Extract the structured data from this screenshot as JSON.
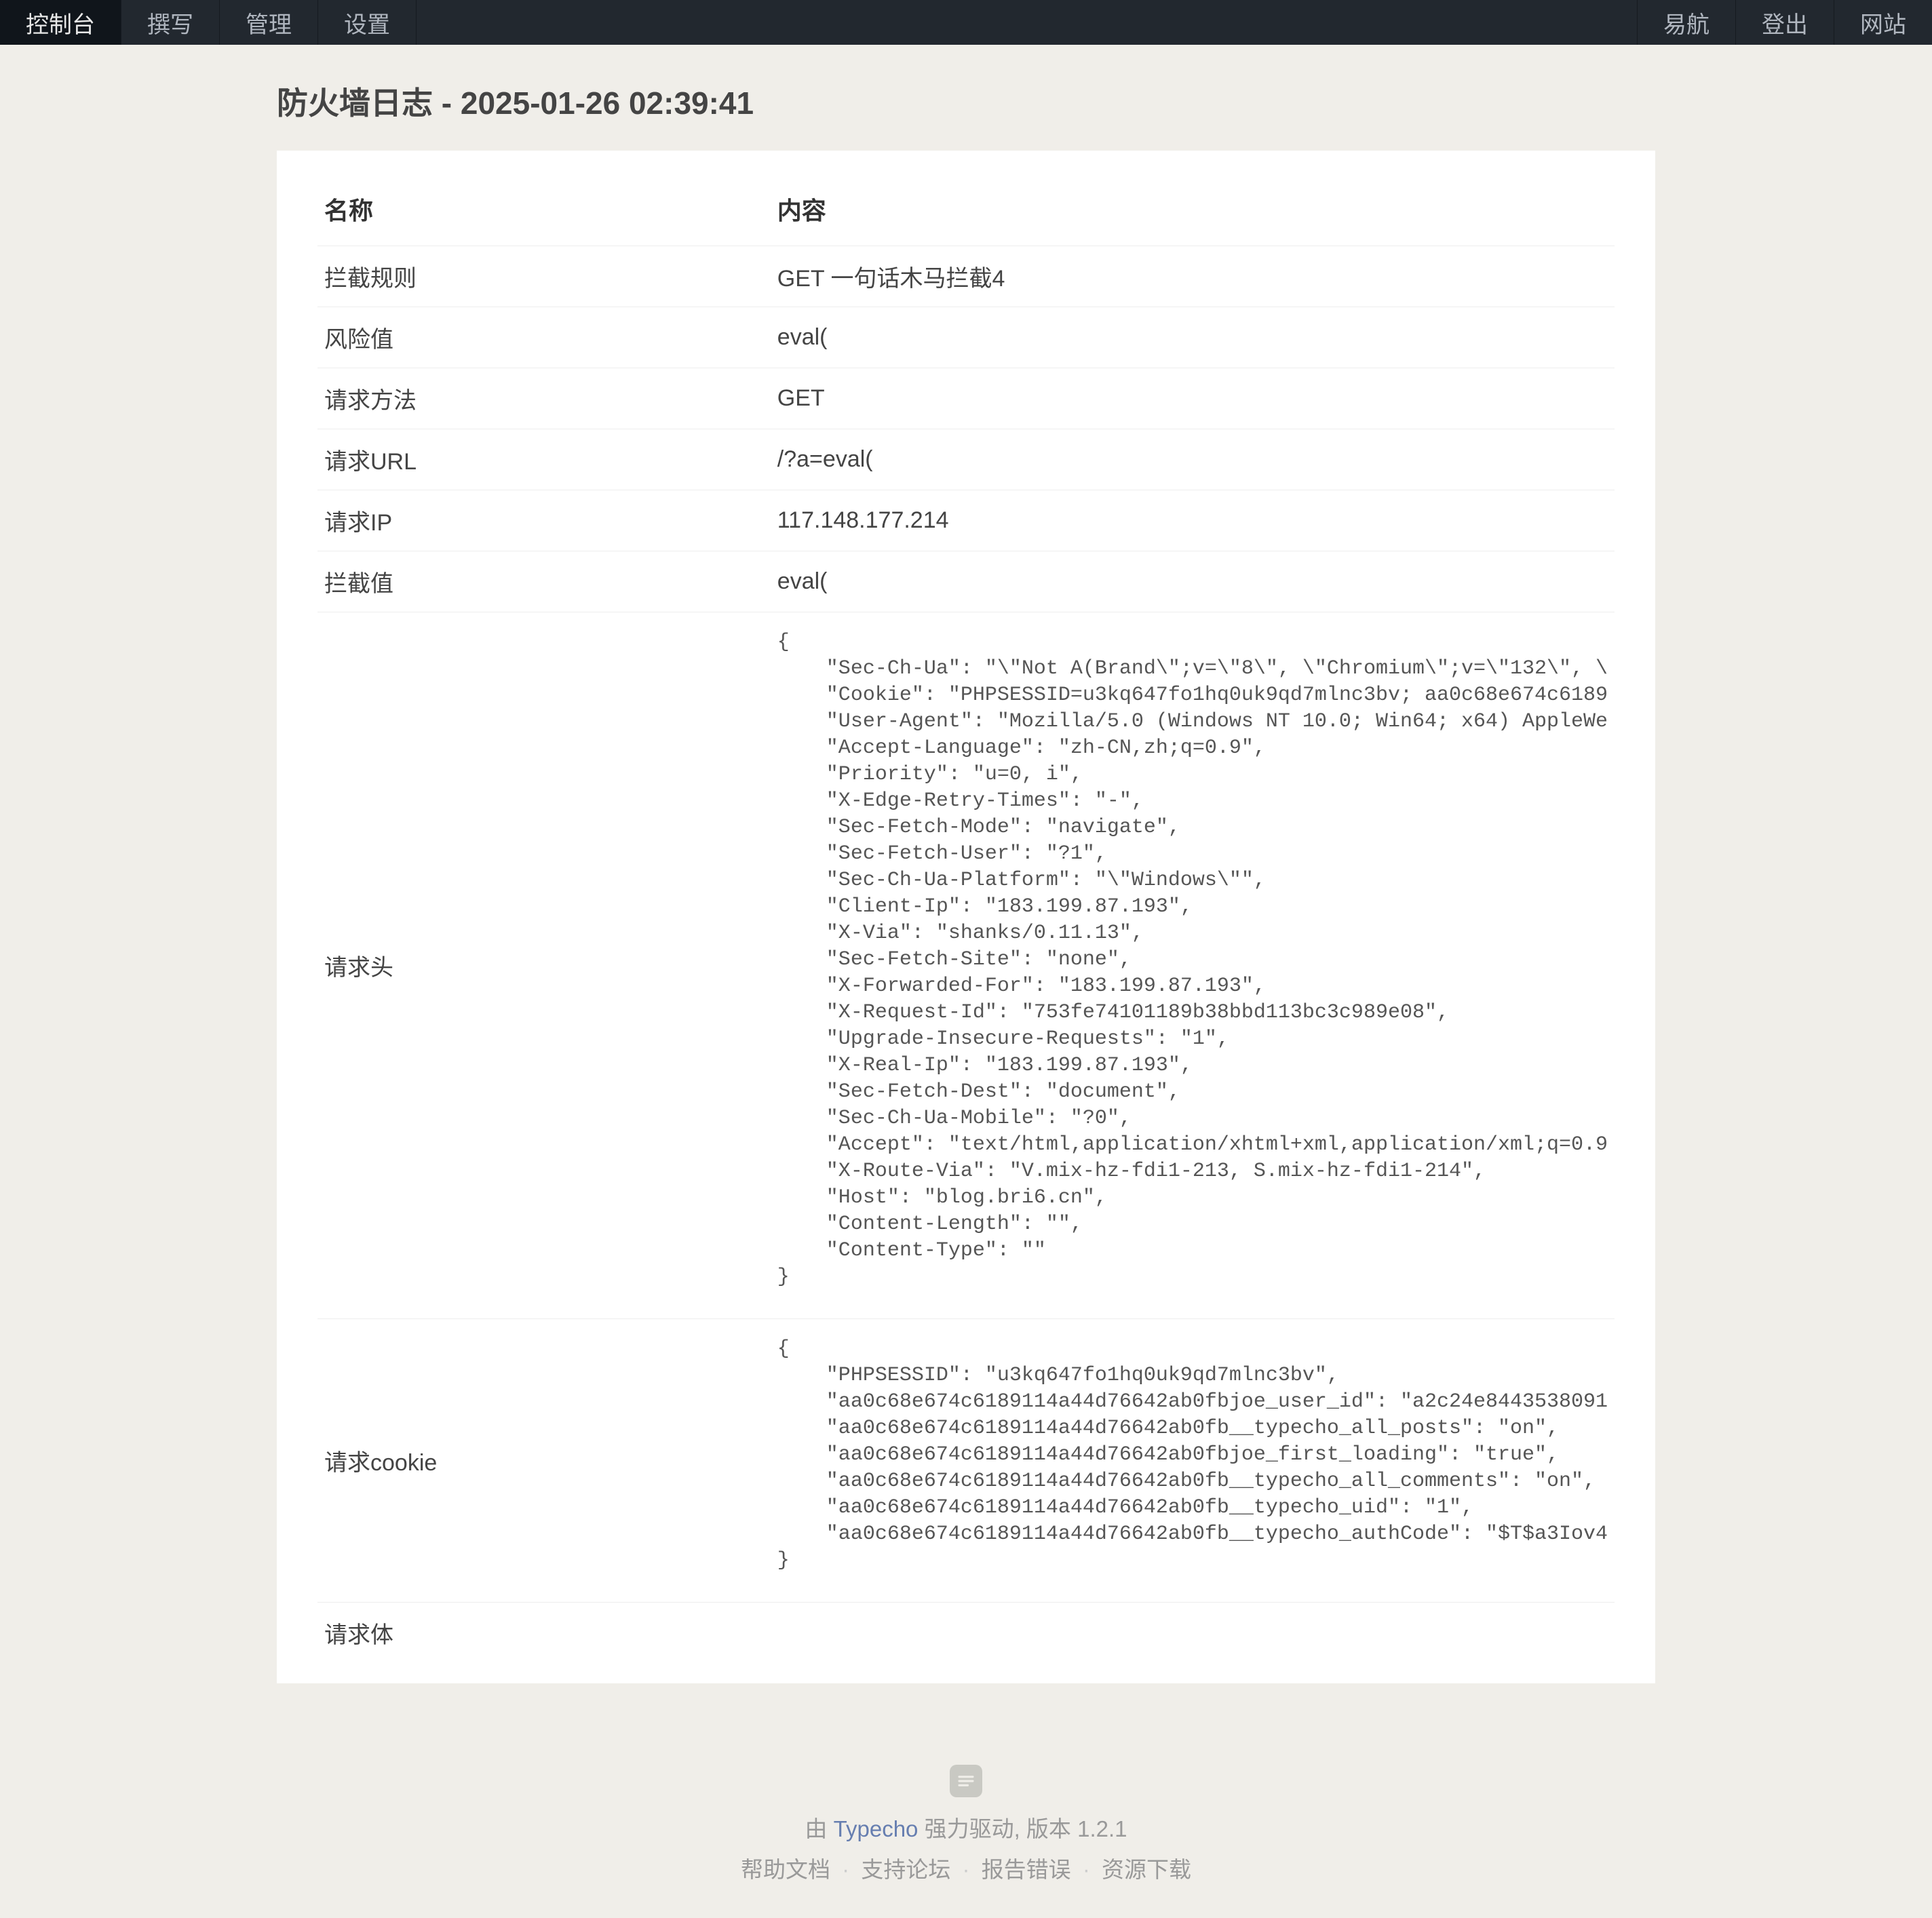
{
  "nav": {
    "left": [
      {
        "label": "控制台",
        "active": true
      },
      {
        "label": "撰写",
        "active": false
      },
      {
        "label": "管理",
        "active": false
      },
      {
        "label": "设置",
        "active": false
      }
    ],
    "right": [
      {
        "label": "易航"
      },
      {
        "label": "登出"
      },
      {
        "label": "网站"
      }
    ]
  },
  "page_title": "防火墙日志 - 2025-01-26 02:39:41",
  "table": {
    "headers": {
      "name": "名称",
      "content": "内容"
    },
    "rows": [
      {
        "name": "拦截规则",
        "content": "GET 一句话木马拦截4"
      },
      {
        "name": "风险值",
        "content": "eval("
      },
      {
        "name": "请求方法",
        "content": "GET"
      },
      {
        "name": "请求URL",
        "content": "/?a=eval("
      },
      {
        "name": "请求IP",
        "content": "117.148.177.214"
      },
      {
        "name": "拦截值",
        "content": "eval("
      }
    ],
    "headers_label": "请求头",
    "headers_block": "{\n    \"Sec-Ch-Ua\": \"\\\"Not A(Brand\\\";v=\\\"8\\\", \\\"Chromium\\\";v=\\\"132\\\", \\\n    \"Cookie\": \"PHPSESSID=u3kq647fo1hq0uk9qd7mlnc3bv; aa0c68e674c6189\n    \"User-Agent\": \"Mozilla/5.0 (Windows NT 10.0; Win64; x64) AppleWe\n    \"Accept-Language\": \"zh-CN,zh;q=0.9\",\n    \"Priority\": \"u=0, i\",\n    \"X-Edge-Retry-Times\": \"-\",\n    \"Sec-Fetch-Mode\": \"navigate\",\n    \"Sec-Fetch-User\": \"?1\",\n    \"Sec-Ch-Ua-Platform\": \"\\\"Windows\\\"\",\n    \"Client-Ip\": \"183.199.87.193\",\n    \"X-Via\": \"shanks/0.11.13\",\n    \"Sec-Fetch-Site\": \"none\",\n    \"X-Forwarded-For\": \"183.199.87.193\",\n    \"X-Request-Id\": \"753fe74101189b38bbd113bc3c989e08\",\n    \"Upgrade-Insecure-Requests\": \"1\",\n    \"X-Real-Ip\": \"183.199.87.193\",\n    \"Sec-Fetch-Dest\": \"document\",\n    \"Sec-Ch-Ua-Mobile\": \"?0\",\n    \"Accept\": \"text/html,application/xhtml+xml,application/xml;q=0.9\n    \"X-Route-Via\": \"V.mix-hz-fdi1-213, S.mix-hz-fdi1-214\",\n    \"Host\": \"blog.bri6.cn\",\n    \"Content-Length\": \"\",\n    \"Content-Type\": \"\"\n}",
    "cookie_label": "请求cookie",
    "cookie_block": "{\n    \"PHPSESSID\": \"u3kq647fo1hq0uk9qd7mlnc3bv\",\n    \"aa0c68e674c6189114a44d76642ab0fbjoe_user_id\": \"a2c24e8443538091\n    \"aa0c68e674c6189114a44d76642ab0fb__typecho_all_posts\": \"on\",\n    \"aa0c68e674c6189114a44d76642ab0fbjoe_first_loading\": \"true\",\n    \"aa0c68e674c6189114a44d76642ab0fb__typecho_all_comments\": \"on\",\n    \"aa0c68e674c6189114a44d76642ab0fb__typecho_uid\": \"1\",\n    \"aa0c68e674c6189114a44d76642ab0fb__typecho_authCode\": \"$T$a3Iov4\n}",
    "body_label": "请求体",
    "body_content": ""
  },
  "footer": {
    "by_prefix": "由 ",
    "typecho": "Typecho",
    "by_suffix": " 强力驱动, 版本 ",
    "version": "1.2.1",
    "links": [
      "帮助文档",
      "支持论坛",
      "报告错误",
      "资源下载"
    ],
    "sep": "·"
  }
}
